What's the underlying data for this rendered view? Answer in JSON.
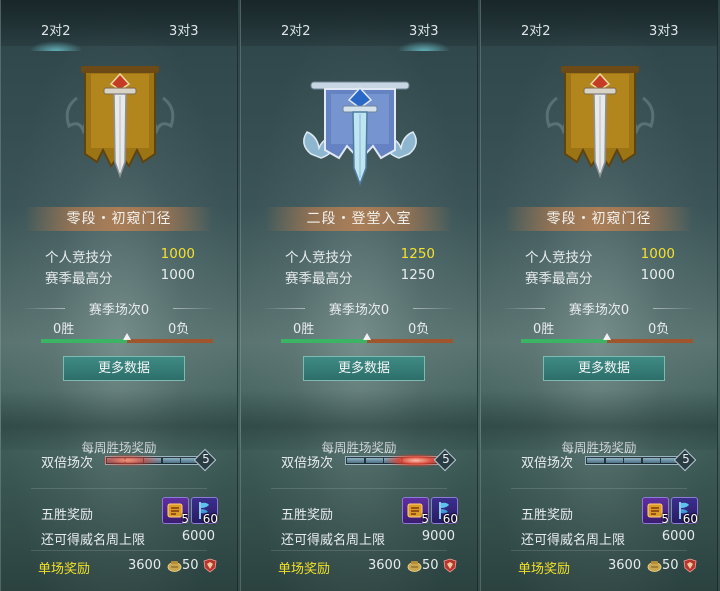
{
  "panels": [
    {
      "tabs": {
        "left": "2对2",
        "right": "3对3"
      },
      "active_tab": "left",
      "emblem": "gold-banner-sword-icon",
      "rank": "零段・初窥门径",
      "personal_score_label": "个人竞技分",
      "personal_score": "1000",
      "season_high_label": "赛季最高分",
      "season_high": "1000",
      "season_matches": "赛季场次0",
      "wins": "0胜",
      "losses": "0负",
      "win_ratio": 0.5,
      "more_button": "更多数据",
      "weekly_title": "每周胜场奖励",
      "double_label": "双倍场次",
      "double_count": "5",
      "double_glow": "faint",
      "five_win_label": "五胜奖励",
      "item1_qty": "5",
      "item2_qty": "60",
      "cap_label": "还可得威名周上限",
      "cap_value": "6000",
      "single_label": "单场奖励",
      "single_coins": "3600",
      "single_honor": "50"
    },
    {
      "tabs": {
        "left": "2对2",
        "right": "3对3"
      },
      "active_tab": "right",
      "emblem": "blue-banner-sword-icon",
      "rank": "二段・登堂入室",
      "personal_score_label": "个人竞技分",
      "personal_score": "1250",
      "season_high_label": "赛季最高分",
      "season_high": "1250",
      "season_matches": "赛季场次0",
      "wins": "0胜",
      "losses": "0负",
      "win_ratio": 0.5,
      "more_button": "更多数据",
      "weekly_title": "每周胜场奖励",
      "double_label": "双倍场次",
      "double_count": "5",
      "double_glow": "strong",
      "five_win_label": "五胜奖励",
      "item1_qty": "5",
      "item2_qty": "60",
      "cap_label": "还可得威名周上限",
      "cap_value": "9000",
      "single_label": "单场奖励",
      "single_coins": "3600",
      "single_honor": "50"
    },
    {
      "tabs": {
        "left": "2对2",
        "right": "3对3"
      },
      "active_tab": "none",
      "emblem": "gold-banner-sword-icon",
      "rank": "零段・初窥门径",
      "personal_score_label": "个人竞技分",
      "personal_score": "1000",
      "season_high_label": "赛季最高分",
      "season_high": "1000",
      "season_matches": "赛季场次0",
      "wins": "0胜",
      "losses": "0负",
      "win_ratio": 0.5,
      "more_button": "更多数据",
      "weekly_title": "每周胜场奖励",
      "double_label": "双倍场次",
      "double_count": "5",
      "double_glow": "none",
      "five_win_label": "五胜奖励",
      "item1_qty": "5",
      "item2_qty": "60",
      "cap_label": "还可得威名周上限",
      "cap_value": "6000",
      "single_label": "单场奖励",
      "single_coins": "3600",
      "single_honor": "50"
    }
  ],
  "colors": {
    "score_highlight": "#f4e12f",
    "single_label": "#f3e02a",
    "win_bar": "#3cb466",
    "loss_bar": "#a0562d",
    "button": "#3f8a84"
  }
}
